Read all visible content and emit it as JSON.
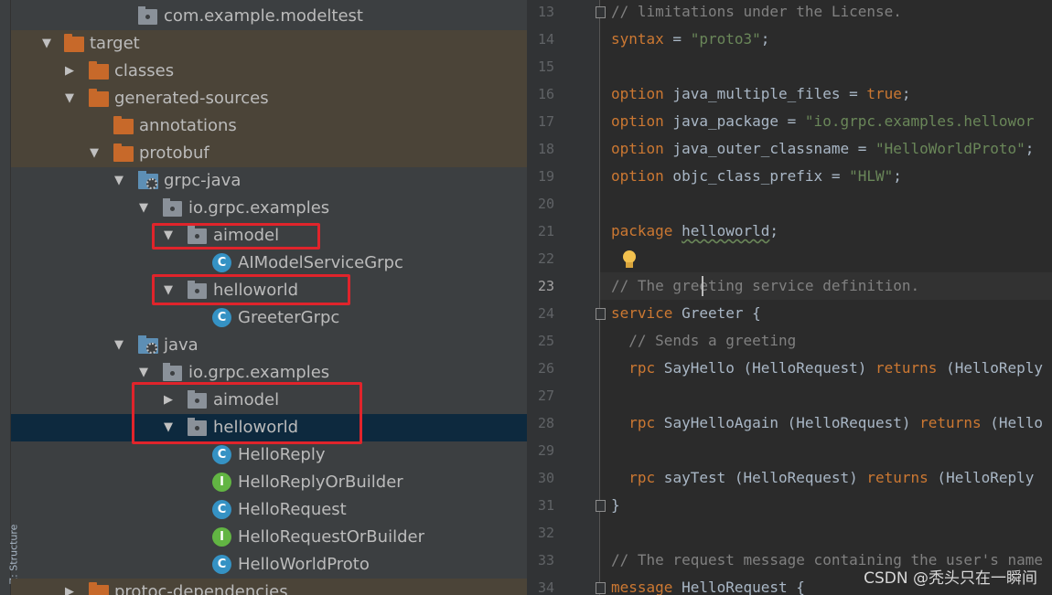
{
  "tree": {
    "side_tab_label": "Z: Structure",
    "rows": [
      {
        "label": "com.example.modeltest",
        "icon": "package-icon"
      },
      {
        "label": "target",
        "icon": "folder-icon"
      },
      {
        "label": "classes",
        "icon": "folder-icon"
      },
      {
        "label": "generated-sources",
        "icon": "folder-icon"
      },
      {
        "label": "annotations",
        "icon": "folder-icon"
      },
      {
        "label": "protobuf",
        "icon": "folder-icon"
      },
      {
        "label": "grpc-java",
        "icon": "source-folder-icon"
      },
      {
        "label": "io.grpc.examples",
        "icon": "package-icon"
      },
      {
        "label": "aimodel",
        "icon": "package-icon"
      },
      {
        "label": "AIModelServiceGrpc",
        "icon": "class-icon",
        "badge": "C"
      },
      {
        "label": "helloworld",
        "icon": "package-icon"
      },
      {
        "label": "GreeterGrpc",
        "icon": "class-icon",
        "badge": "C"
      },
      {
        "label": "java",
        "icon": "source-folder-icon"
      },
      {
        "label": "io.grpc.examples",
        "icon": "package-icon"
      },
      {
        "label": "aimodel",
        "icon": "package-icon"
      },
      {
        "label": "helloworld",
        "icon": "package-icon"
      },
      {
        "label": "HelloReply",
        "icon": "class-icon",
        "badge": "C"
      },
      {
        "label": "HelloReplyOrBuilder",
        "icon": "interface-icon",
        "badge": "I"
      },
      {
        "label": "HelloRequest",
        "icon": "class-icon",
        "badge": "C"
      },
      {
        "label": "HelloRequestOrBuilder",
        "icon": "interface-icon",
        "badge": "I"
      },
      {
        "label": "HelloWorldProto",
        "icon": "class-icon",
        "badge": "C"
      },
      {
        "label": "protoc-dependencies",
        "icon": "folder-icon"
      }
    ]
  },
  "editor": {
    "current_line": "23",
    "lines": [
      {
        "n": "13",
        "parts": [
          [
            "cm",
            "// limitations under the License."
          ]
        ]
      },
      {
        "n": "14",
        "parts": [
          [
            "kw",
            "syntax"
          ],
          [
            "",
            " = "
          ],
          [
            "str",
            "\"proto3\""
          ],
          [
            "",
            ";"
          ]
        ]
      },
      {
        "n": "15",
        "parts": []
      },
      {
        "n": "16",
        "parts": [
          [
            "kw",
            "option"
          ],
          [
            "",
            " java_multiple_files = "
          ],
          [
            "kw",
            "true"
          ],
          [
            "",
            ";"
          ]
        ]
      },
      {
        "n": "17",
        "parts": [
          [
            "kw",
            "option"
          ],
          [
            "",
            " java_package = "
          ],
          [
            "str",
            "\"io.grpc.examples.hellowor"
          ]
        ]
      },
      {
        "n": "18",
        "parts": [
          [
            "kw",
            "option"
          ],
          [
            "",
            " java_outer_classname = "
          ],
          [
            "str",
            "\"HelloWorldProto\""
          ],
          [
            "",
            ";"
          ]
        ]
      },
      {
        "n": "19",
        "parts": [
          [
            "kw",
            "option"
          ],
          [
            "",
            " objc_class_prefix = "
          ],
          [
            "str",
            "\"HLW\""
          ],
          [
            "",
            ";"
          ]
        ]
      },
      {
        "n": "20",
        "parts": []
      },
      {
        "n": "21",
        "parts": [
          [
            "kw",
            "package"
          ],
          [
            "",
            " "
          ],
          [
            "wavy",
            "helloworld"
          ],
          [
            "",
            ";"
          ]
        ]
      },
      {
        "n": "22",
        "parts": []
      },
      {
        "n": "23",
        "parts": [
          [
            "cm",
            "// The greeting service definition."
          ]
        ]
      },
      {
        "n": "24",
        "parts": [
          [
            "kw",
            "service"
          ],
          [
            "",
            " Greeter {"
          ]
        ]
      },
      {
        "n": "25",
        "parts": [
          [
            "cm",
            "  // Sends a greeting"
          ]
        ]
      },
      {
        "n": "26",
        "parts": [
          [
            "",
            "  "
          ],
          [
            "kw",
            "rpc"
          ],
          [
            "",
            " SayHello (HelloRequest) "
          ],
          [
            "kw",
            "returns"
          ],
          [
            "",
            " (HelloReply"
          ]
        ]
      },
      {
        "n": "27",
        "parts": []
      },
      {
        "n": "28",
        "parts": [
          [
            "",
            "  "
          ],
          [
            "kw",
            "rpc"
          ],
          [
            "",
            " SayHelloAgain (HelloRequest) "
          ],
          [
            "kw",
            "returns"
          ],
          [
            "",
            " (Hello"
          ]
        ]
      },
      {
        "n": "29",
        "parts": []
      },
      {
        "n": "30",
        "parts": [
          [
            "",
            "  "
          ],
          [
            "kw",
            "rpc"
          ],
          [
            "",
            " sayTest (HelloRequest) "
          ],
          [
            "kw",
            "returns"
          ],
          [
            "",
            " (HelloReply"
          ]
        ]
      },
      {
        "n": "31",
        "parts": [
          [
            "",
            "}"
          ]
        ]
      },
      {
        "n": "32",
        "parts": []
      },
      {
        "n": "33",
        "parts": [
          [
            "cm",
            "// The request message containing the user's name"
          ]
        ]
      },
      {
        "n": "34",
        "parts": [
          [
            "kw",
            "message"
          ],
          [
            "",
            " HelloRequest {"
          ]
        ]
      }
    ]
  },
  "watermark": "CSDN @秃头只在一瞬间",
  "colors": {
    "annotation_red": "#e0242b",
    "selection": "#0d293e",
    "excluded_folder_bg": "#4b4438"
  }
}
